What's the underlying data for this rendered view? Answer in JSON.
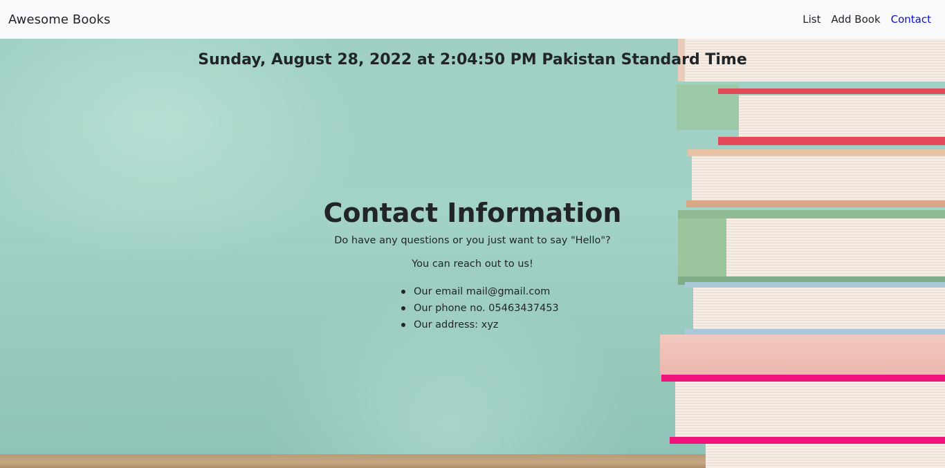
{
  "navbar": {
    "brand": "Awesome Books",
    "links": [
      {
        "label": "List",
        "active": false
      },
      {
        "label": "Add Book",
        "active": false
      },
      {
        "label": "Contact",
        "active": true
      }
    ]
  },
  "datetime": "Sunday, August 28, 2022 at 2:04:50 PM Pakistan Standard Time",
  "contact": {
    "title": "Contact Information",
    "question": "Do have any questions or you just want to say \"Hello\"?",
    "reach": "You can reach out to us!",
    "items": [
      "Our email mail@gmail.com",
      "Our phone no. 05463437453",
      "Our address: xyz"
    ]
  },
  "colors": {
    "navbar_bg": "#f8f9fa",
    "active_link": "#0d0dcc",
    "chalkboard": "#a3d2c6"
  }
}
